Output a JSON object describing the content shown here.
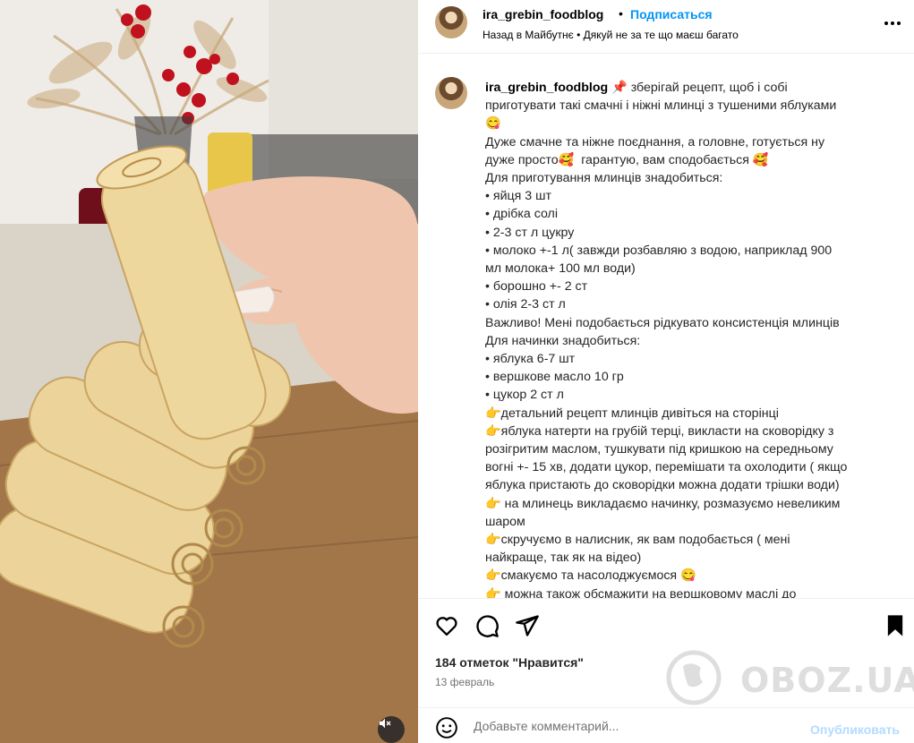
{
  "header": {
    "username": "ira_grebin_foodblog",
    "separator": "•",
    "follow_label": "Подписаться",
    "audio_line": "Назад в Майбутнє • Дякуй не за те що маєш багато",
    "more_icon": "more-horizontal-icon"
  },
  "caption": {
    "username": "ira_grebin_foodblog",
    "lines": [
      "📌 зберігай рецепт, щоб і собі",
      "приготувати такі смачні і ніжні млинці з тушеними яблуками",
      "😋",
      "Дуже смачне та ніжне поєднання, а головне, готується ну",
      "дуже просто🥰  гарантую, вам сподобається 🥰",
      "Для приготування млинців знадобиться:",
      "• яйця 3 шт",
      "• дрібка солі",
      "• 2-3 ст л цукру",
      "• молоко +-1 л( завжди розбавляю з водою, наприклад 900",
      "мл молока+ 100 мл води)",
      "• борошно +- 2 ст",
      "• олія 2-3 ст л",
      "Важливо! Мені подобається рідкувато консистенція млинців",
      "Для начинки знадобиться:",
      "• яблука 6-7 шт",
      "• вершкове масло 10 гр",
      "• цукор 2 ст л",
      "👉детальний рецепт млинців дивіться на сторінці",
      "👉яблука натерти на грубій терці, викласти на сковорідку з",
      "розігритим маслом, тушкувати під кришкою на середньому",
      "вогні +- 15 хв, додати цукор, перемішати та охолодити ( якщо",
      "яблука пристають до сковорідки можна додати трішки води)",
      "👉 на млинець викладаємо начинку, розмазуємо невеликим",
      "шаром",
      "👉скручуємо в налисник, як вам подобається ( мені",
      "найкраще, так як на відео)",
      "👉смакуємо та насолоджуємося 😋",
      "👉 можна також обсмажити на вершковому маслі до"
    ]
  },
  "actions": {
    "like_icon": "heart-icon",
    "comment_icon": "comment-icon",
    "share_icon": "share-icon",
    "save_icon": "bookmark-icon"
  },
  "stats": {
    "likes": "184 отметок \"Нравится\"",
    "date": "13 февраль"
  },
  "watermark": {
    "text": "OBOZ.UA"
  },
  "comment": {
    "placeholder": "Добавьте комментарий...",
    "publish_label": "Опубликовать"
  },
  "media": {
    "mute_icon": "muted-speaker-icon",
    "accent": "#0095f6"
  }
}
